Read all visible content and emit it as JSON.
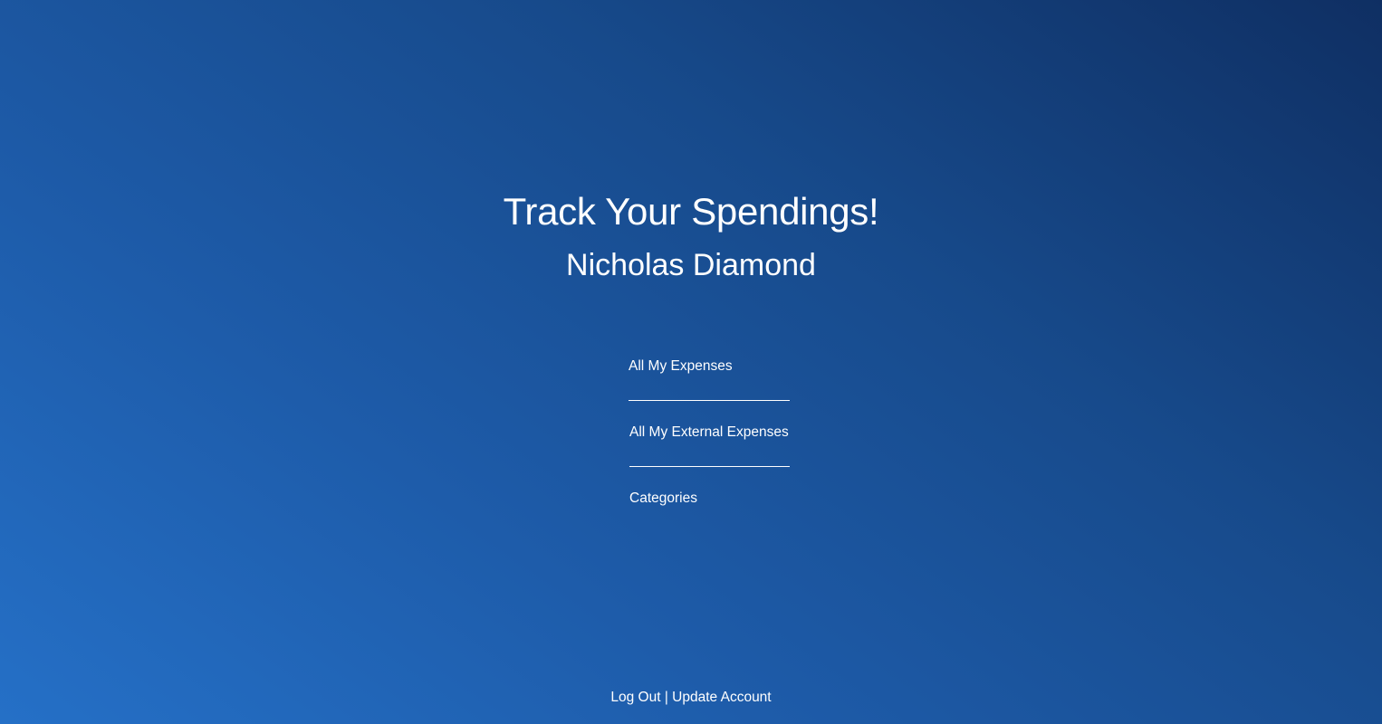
{
  "header": {
    "title": "Track Your Spendings!",
    "username": "Nicholas Diamond"
  },
  "menu": {
    "items": [
      {
        "label": "All My Expenses"
      },
      {
        "label": "All My External Expenses"
      },
      {
        "label": "Categories"
      }
    ]
  },
  "footer": {
    "logout_label": "Log Out",
    "separator": "|",
    "update_account_label": "Update Account"
  },
  "colors": {
    "gradient_light": "#2570c7",
    "gradient_dark": "#0f2f63",
    "text": "#ffffff"
  }
}
